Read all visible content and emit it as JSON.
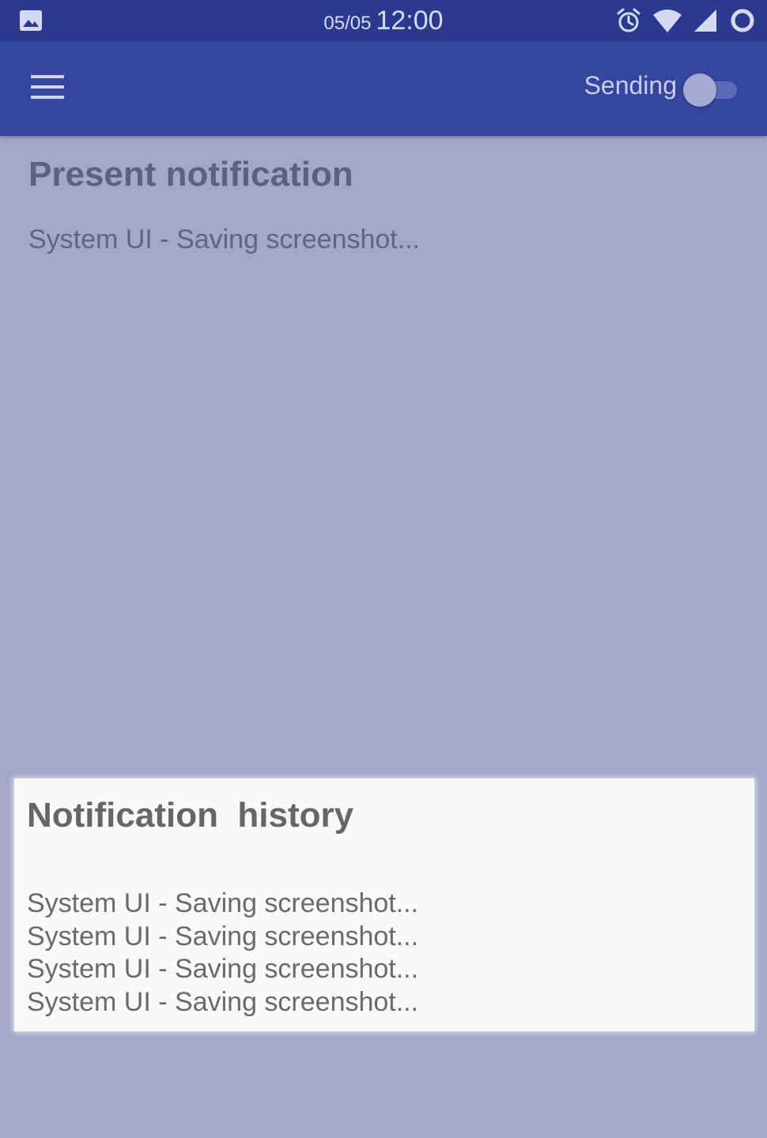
{
  "status_bar": {
    "date": "05/05",
    "time": "12:00",
    "left_icon": "image-icon",
    "right_icons": [
      "alarm-icon",
      "wifi-icon",
      "cellular-signal-icon",
      "sync-circle-icon"
    ]
  },
  "app_bar": {
    "menu_icon": "hamburger-menu-icon",
    "sending_label": "Sending",
    "sending_enabled": false
  },
  "present": {
    "title": "Present notification",
    "item": "System UI - Saving screenshot..."
  },
  "history": {
    "title": "Notification  history",
    "items": [
      "System UI - Saving screenshot...",
      "System UI - Saving screenshot...",
      "System UI - Saving screenshot...",
      "System UI - Saving screenshot..."
    ]
  },
  "colors": {
    "status_bar": "#2b3a8f",
    "app_bar": "#3545a0",
    "overlay_background": "#a3a7c8",
    "card_background": "#f9f9f9"
  }
}
